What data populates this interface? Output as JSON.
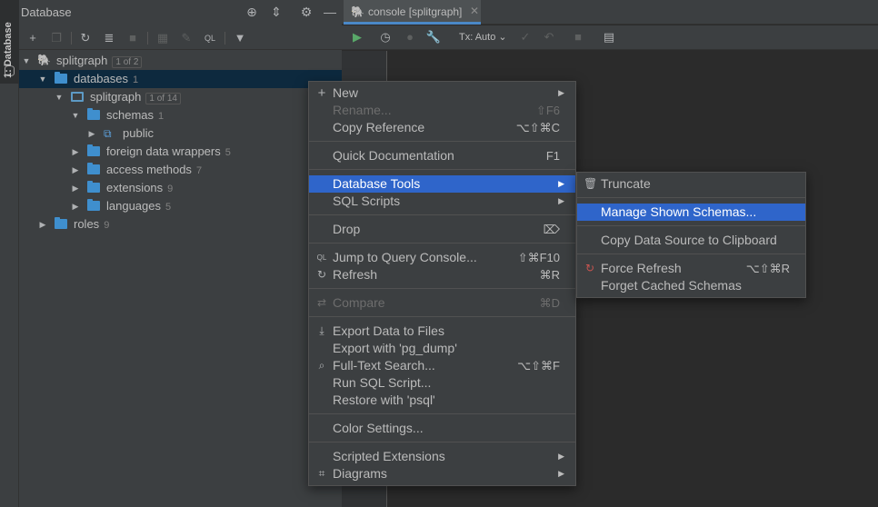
{
  "tool_window": {
    "stripe_label": "1: Database"
  },
  "db_panel": {
    "title": "Database",
    "tree": [
      {
        "label": "splitgraph",
        "badge": "1 of 2",
        "expanded": true
      },
      {
        "label": "databases",
        "count": "1",
        "expanded": true,
        "selected": true
      },
      {
        "label": "splitgraph",
        "badge": "1 of 14",
        "expanded": true
      },
      {
        "label": "schemas",
        "count": "1",
        "expanded": true
      },
      {
        "label": "public",
        "count": "",
        "expanded": false
      },
      {
        "label": "foreign data wrappers",
        "count": "5",
        "expanded": false
      },
      {
        "label": "access methods",
        "count": "7",
        "expanded": false
      },
      {
        "label": "extensions",
        "count": "9",
        "expanded": false
      },
      {
        "label": "languages",
        "count": "5",
        "expanded": false
      },
      {
        "label": "roles",
        "count": "9",
        "expanded": false
      }
    ]
  },
  "editor": {
    "tab_label": "console [splitgraph]",
    "tx_mode": "Tx: Auto"
  },
  "context_menu": {
    "items": [
      {
        "label": "New",
        "shortcut": "",
        "submenu": true,
        "disabled": false
      },
      {
        "label": "Rename...",
        "shortcut": "⇧F6",
        "disabled": true
      },
      {
        "label": "Copy Reference",
        "shortcut": "⌥⇧⌘C",
        "disabled": false
      },
      {
        "label": "Quick Documentation",
        "shortcut": "F1",
        "disabled": false
      },
      {
        "label": "Database Tools",
        "shortcut": "",
        "submenu": true,
        "highlighted": true
      },
      {
        "label": "SQL Scripts",
        "shortcut": "",
        "submenu": true
      },
      {
        "label": "Drop",
        "shortcut": "⌦"
      },
      {
        "label": "Jump to Query Console...",
        "shortcut": "⇧⌘F10"
      },
      {
        "label": "Refresh",
        "shortcut": "⌘R"
      },
      {
        "label": "Compare",
        "shortcut": "⌘D",
        "disabled": true
      },
      {
        "label": "Export Data to Files",
        "shortcut": ""
      },
      {
        "label": "Export with 'pg_dump'",
        "shortcut": ""
      },
      {
        "label": "Full-Text Search...",
        "shortcut": "⌥⇧⌘F"
      },
      {
        "label": "Run SQL Script...",
        "shortcut": ""
      },
      {
        "label": "Restore with 'psql'",
        "shortcut": ""
      },
      {
        "label": "Color Settings...",
        "shortcut": ""
      },
      {
        "label": "Scripted Extensions",
        "shortcut": "",
        "submenu": true
      },
      {
        "label": "Diagrams",
        "shortcut": "",
        "submenu": true
      }
    ]
  },
  "submenu": {
    "items": [
      {
        "label": "Truncate",
        "shortcut": ""
      },
      {
        "label": "Manage Shown Schemas...",
        "shortcut": "",
        "highlighted": true
      },
      {
        "label": "Copy Data Source to Clipboard",
        "shortcut": ""
      },
      {
        "label": "Force Refresh",
        "shortcut": "⌥⇧⌘R"
      },
      {
        "label": "Forget Cached Schemas",
        "shortcut": ""
      }
    ]
  },
  "colors": {
    "highlight": "#2f65ca",
    "selected_row": "#0d293e",
    "run_green": "#59a869",
    "folder_blue": "#3f8fce"
  }
}
